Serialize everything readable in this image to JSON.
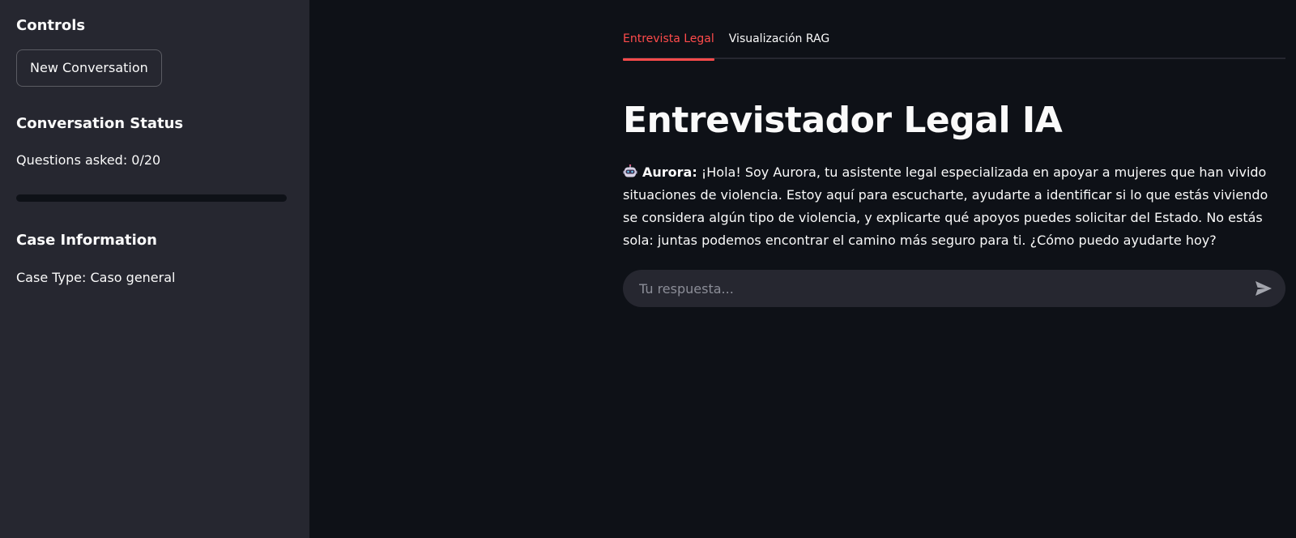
{
  "sidebar": {
    "controls_heading": "Controls",
    "new_conversation_label": "New Conversation",
    "status_heading": "Conversation Status",
    "questions_asked": "Questions asked: 0/20",
    "progress_fraction": 0,
    "case_heading": "Case Information",
    "case_type": "Case Type: Caso general"
  },
  "tabs": [
    {
      "label": "Entrevista Legal",
      "active": true
    },
    {
      "label": "Visualización RAG",
      "active": false
    }
  ],
  "main": {
    "title": "Entrevistador Legal IA",
    "message": {
      "icon": "robot-icon",
      "speaker": "Aurora:",
      "text": "¡Hola! Soy Aurora, tu asistente legal especializada en apoyar a mujeres que han vivido situaciones de violencia. Estoy aquí para escucharte, ayudarte a identificar si lo que estás viviendo se considera algún tipo de violencia, y explicarte qué apoyos puedes solicitar del Estado. No estás sola: juntas podemos encontrar el camino más seguro para ti. ¿Cómo puedo ayudarte hoy?"
    },
    "chat_input": {
      "placeholder": "Tu respuesta...",
      "value": "",
      "send_icon": "send-icon"
    }
  },
  "colors": {
    "accent": "#ff4b4b",
    "sidebar_bg": "#262730",
    "main_bg": "#0e1117",
    "text": "#fafafa"
  }
}
